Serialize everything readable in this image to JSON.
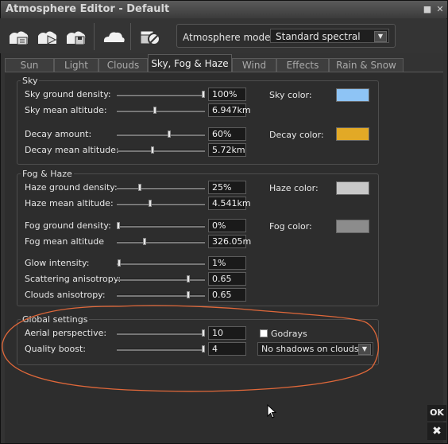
{
  "window": {
    "title": "Atmosphere Editor - Default"
  },
  "toolbar": {
    "model_label": "Atmosphere model:",
    "model_value": "Standard spectral",
    "tools": [
      "load-preset-icon",
      "save-preset-icon",
      "reset-preset-icon",
      "cloud-icon",
      "clapper-icon"
    ]
  },
  "tabs": [
    "Sun",
    "Light",
    "Clouds",
    "Sky, Fog & Haze",
    "Wind",
    "Effects",
    "Rain & Snow"
  ],
  "active_tab": "Sky, Fog & Haze",
  "sky": {
    "title": "Sky",
    "rows": [
      {
        "label": "Sky ground density:",
        "value": "100%",
        "level": 1.0
      },
      {
        "label": "Sky mean altitude:",
        "value": "6.947km",
        "level": 0.43
      },
      {
        "label": "Decay amount:",
        "value": "60%",
        "level": 0.6
      },
      {
        "label": "Decay mean altitude:",
        "value": "5.72km",
        "level": 0.4
      }
    ],
    "sky_color_label": "Sky color:",
    "sky_color": "#8ec4f5",
    "decay_color_label": "Decay color:",
    "decay_color": "#e2a926"
  },
  "fog": {
    "title": "Fog & Haze",
    "rows": [
      {
        "label": "Haze ground density:",
        "value": "25%",
        "level": 0.25
      },
      {
        "label": "Haze mean altitude:",
        "value": "4.541km",
        "level": 0.37
      },
      {
        "label": "Fog ground density:",
        "value": "0%",
        "level": 0.0
      },
      {
        "label": "Fog mean altitude",
        "value": "326.05m",
        "level": 0.31
      },
      {
        "label": "Glow intensity:",
        "value": "1%",
        "level": 0.01
      },
      {
        "label": "Scattering anisotropy:",
        "value": "0.65",
        "level": 0.82
      },
      {
        "label": "Clouds anisotropy:",
        "value": "0.65",
        "level": 0.82
      }
    ],
    "haze_color_label": "Haze color:",
    "haze_color": "#c8c8c8",
    "fog_color_label": "Fog color:",
    "fog_color": "#8c8c8c"
  },
  "global": {
    "title": "Global settings",
    "rows": [
      {
        "label": "Aerial perspective:",
        "value": "10",
        "level": 1.0
      },
      {
        "label": "Quality boost:",
        "value": "4",
        "level": 1.0
      }
    ],
    "godrays_label": "Godrays",
    "godrays_checked": false,
    "shadows_value": "No shadows on clouds"
  },
  "buttons": {
    "ok": "OK",
    "close": "✖"
  },
  "annotation_color": "#e0683a"
}
